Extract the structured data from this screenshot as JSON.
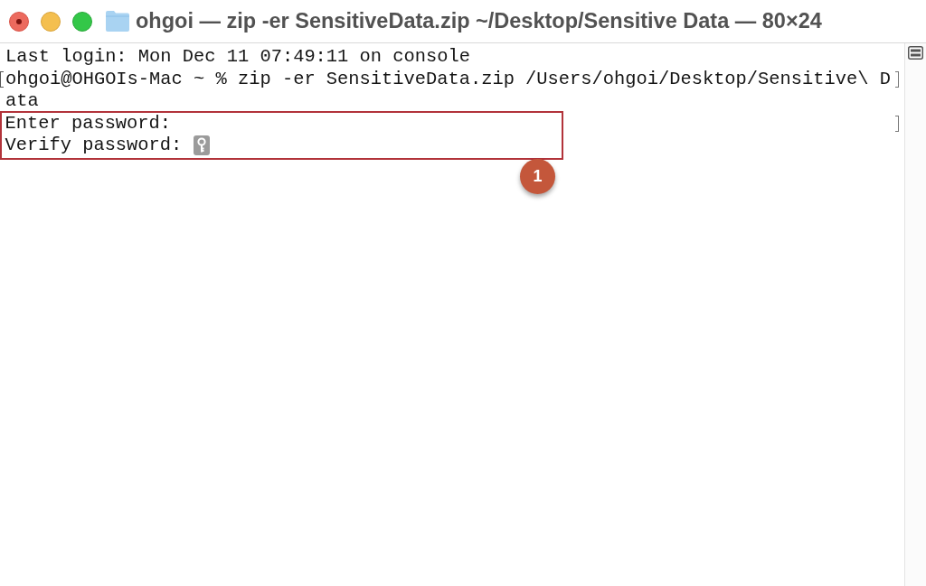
{
  "window": {
    "title": "ohgoi — zip -er SensitiveData.zip ~/Desktop/Sensitive Data — 80×24"
  },
  "terminal": {
    "lines": [
      {
        "text": "Last login: Mon Dec 11 07:49:11 on console",
        "mark_start": false,
        "mark_end": false,
        "highlighted": false,
        "cursor": false
      },
      {
        "text": "ohgoi@OHGOIs-Mac ~ % zip -er SensitiveData.zip /Users/ohgoi/Desktop/Sensitive\\ D",
        "mark_start": true,
        "mark_end": true,
        "highlighted": false,
        "cursor": false
      },
      {
        "text": "ata",
        "mark_start": false,
        "mark_end": false,
        "highlighted": false,
        "cursor": false
      },
      {
        "text": "Enter password:",
        "mark_start": false,
        "mark_end": true,
        "highlighted": true,
        "cursor": false
      },
      {
        "text": "Verify password:",
        "mark_start": false,
        "mark_end": false,
        "highlighted": true,
        "cursor": true
      }
    ]
  },
  "annotation": {
    "label": "1"
  }
}
